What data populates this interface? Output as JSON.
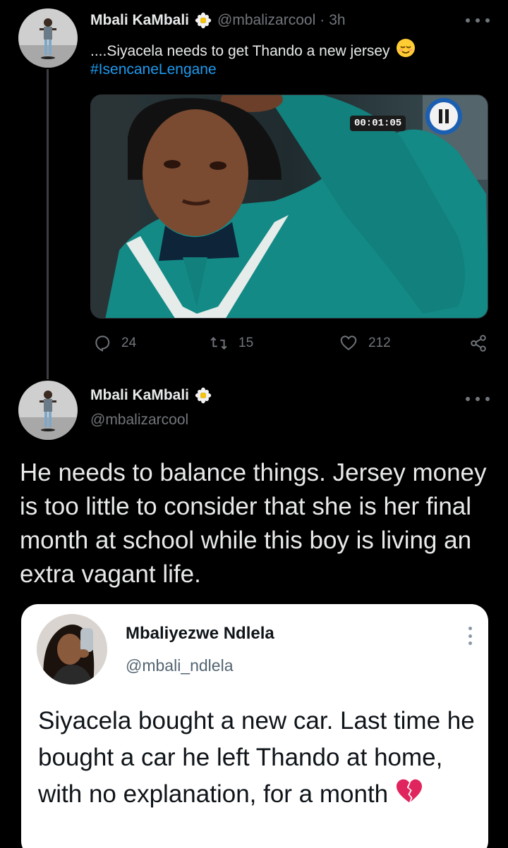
{
  "tweet": {
    "author_name": "Mbali KaMbali",
    "handle": "@mbalizarcool",
    "separator": "·",
    "time": "3h",
    "text": "....Siyacela needs to get Thando a new jersey",
    "hashtag": "#IsencaneLengane",
    "video_time": "00:01:05",
    "replies": "24",
    "retweets": "15",
    "likes": "212"
  },
  "reply": {
    "author_name": "Mbali KaMbali",
    "handle": "@mbalizarcool",
    "text": "He needs to balance things. Jersey money is too little to consider that she is her final month at school while this boy is living an extra vagant life."
  },
  "quoted": {
    "author_name": "Mbaliyezwe Ndlela",
    "handle": "@mbali_ndlela",
    "text": "Siyacela bought a new car. Last time he bought a car he left Thando at home, with no explanation, for a month"
  },
  "colors": {
    "background": "#000000",
    "link": "#1d9bf0",
    "muted": "#71767b"
  },
  "icons": [
    "flower-badge-icon",
    "relieved-face-emoji",
    "reply-icon",
    "retweet-icon",
    "like-icon",
    "share-icon",
    "more-icon",
    "pause-icon",
    "broken-heart-emoji"
  ]
}
